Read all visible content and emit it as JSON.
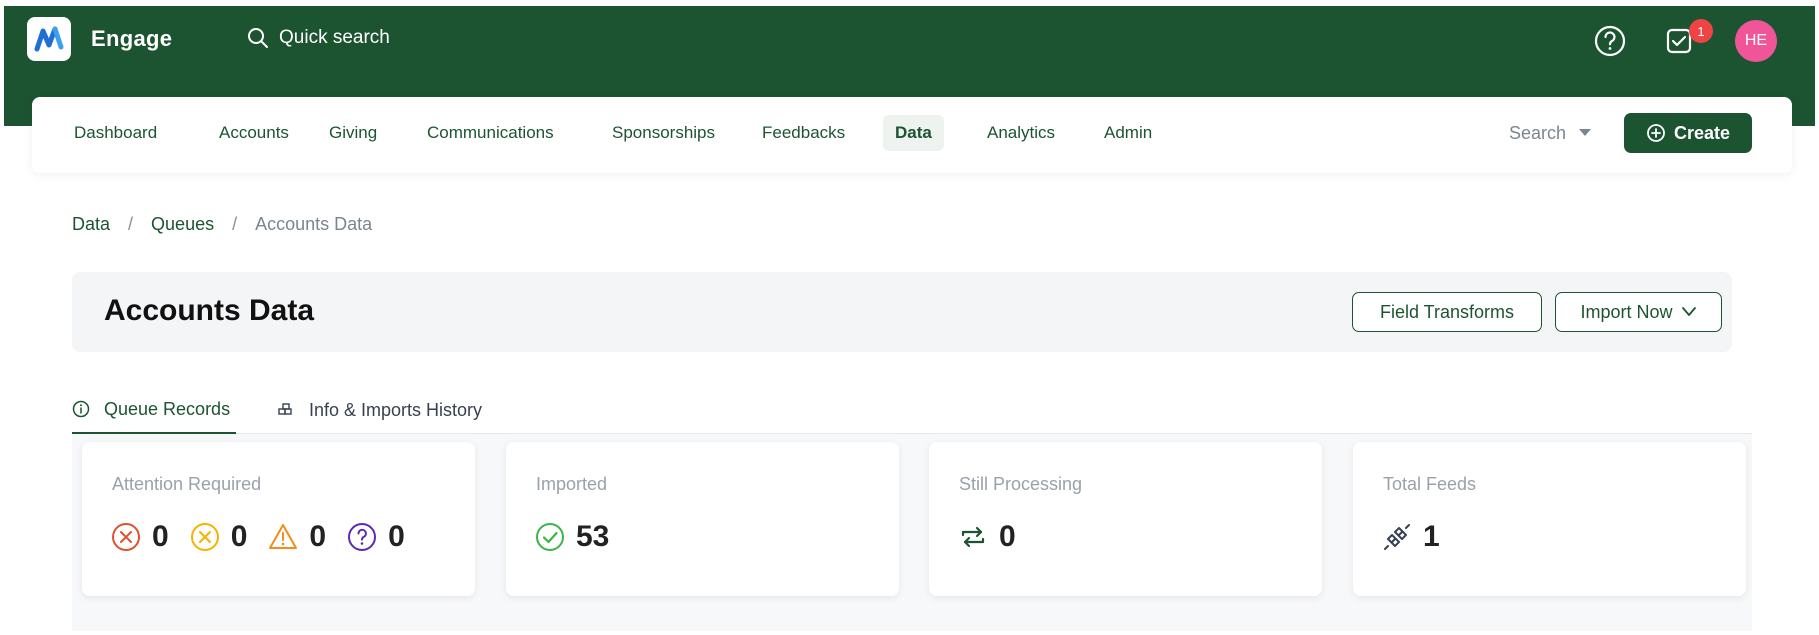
{
  "app": {
    "title": "Engage",
    "quick_search_label": "Quick search"
  },
  "header": {
    "notification_count": "1",
    "avatar_initials": "HE"
  },
  "nav": {
    "items": [
      {
        "label": "Dashboard"
      },
      {
        "label": "Accounts"
      },
      {
        "label": "Giving"
      },
      {
        "label": "Communications"
      },
      {
        "label": "Sponsorships"
      },
      {
        "label": "Feedbacks"
      },
      {
        "label": "Data",
        "active": true
      },
      {
        "label": "Analytics"
      },
      {
        "label": "Admin"
      }
    ],
    "search_label": "Search",
    "create_label": "Create"
  },
  "breadcrumb": {
    "items": [
      "Data",
      "Queues"
    ],
    "current": "Accounts Data"
  },
  "page": {
    "title": "Accounts Data",
    "field_transforms_label": "Field Transforms",
    "import_now_label": "Import Now"
  },
  "tabs": [
    {
      "label": "Queue Records",
      "active": true
    },
    {
      "label": "Info & Imports History",
      "active": false
    }
  ],
  "stats": {
    "attention": {
      "label": "Attention Required",
      "items": [
        {
          "icon": "error-x-circle-icon",
          "value": "0",
          "color": "#e0522b"
        },
        {
          "icon": "skipped-x-circle-icon",
          "value": "0",
          "color": "#f5b301"
        },
        {
          "icon": "warning-triangle-icon",
          "value": "0",
          "color": "#f28c1b"
        },
        {
          "icon": "question-circle-icon",
          "value": "0",
          "color": "#5b2bb3"
        }
      ]
    },
    "imported": {
      "label": "Imported",
      "value": "53",
      "icon": "check-circle-icon",
      "color": "#3bb54a"
    },
    "processing": {
      "label": "Still Processing",
      "value": "0",
      "icon": "repeat-icon",
      "color": "#1c5431"
    },
    "feeds": {
      "label": "Total Feeds",
      "value": "1",
      "icon": "plug-link-icon",
      "color": "#374151"
    }
  },
  "colors": {
    "brand": "#1c5431",
    "badge": "#ef4444",
    "avatar": "#f0559a"
  }
}
